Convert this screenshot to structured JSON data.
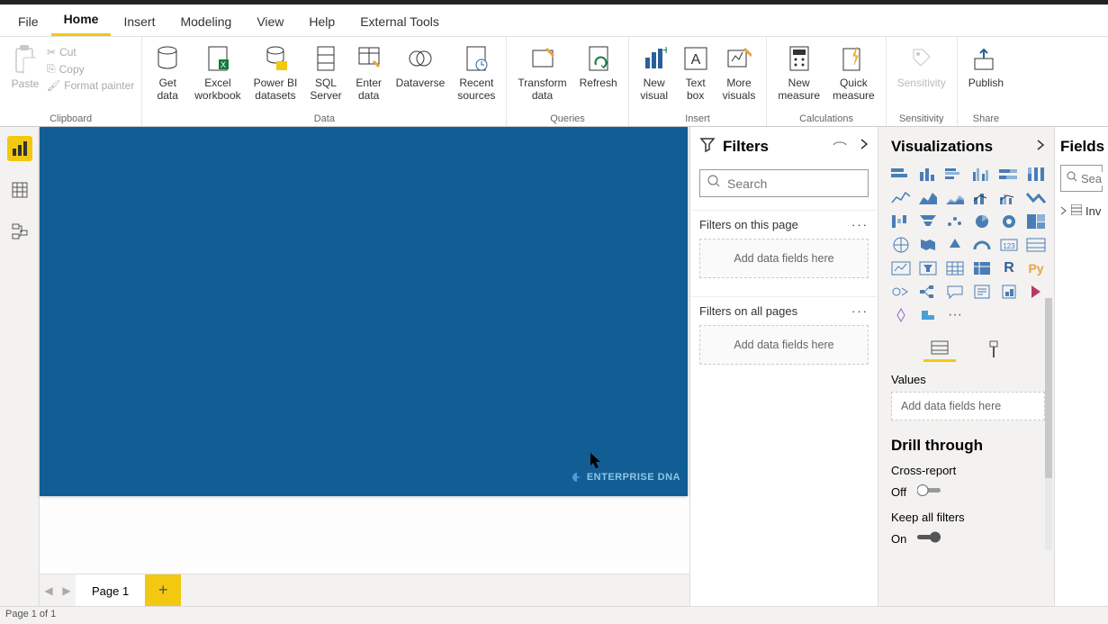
{
  "menu": {
    "file": "File",
    "home": "Home",
    "insert": "Insert",
    "modeling": "Modeling",
    "view": "View",
    "help": "Help",
    "external": "External Tools"
  },
  "clipboard": {
    "group": "Clipboard",
    "paste": "Paste",
    "cut": "Cut",
    "copy": "Copy",
    "format_painter": "Format painter"
  },
  "datagrp": {
    "group": "Data",
    "get_data": "Get\ndata",
    "excel": "Excel\nworkbook",
    "pbi_ds": "Power BI\ndatasets",
    "sql": "SQL\nServer",
    "enter": "Enter\ndata",
    "dataverse": "Dataverse",
    "recent": "Recent\nsources"
  },
  "queries": {
    "group": "Queries",
    "transform": "Transform\ndata",
    "refresh": "Refresh"
  },
  "insertgrp": {
    "group": "Insert",
    "new_visual": "New\nvisual",
    "text_box": "Text\nbox",
    "more": "More\nvisuals"
  },
  "calc": {
    "group": "Calculations",
    "new_measure": "New\nmeasure",
    "quick": "Quick\nmeasure"
  },
  "sens": {
    "group": "Sensitivity",
    "label": "Sensitivity"
  },
  "share": {
    "group": "Share",
    "publish": "Publish"
  },
  "filters": {
    "title": "Filters",
    "search_ph": "Search",
    "on_page": "Filters on this page",
    "on_all": "Filters on all pages",
    "add_here": "Add data fields here"
  },
  "viz": {
    "title": "Visualizations",
    "values": "Values",
    "add_here": "Add data fields here",
    "drill": "Drill through",
    "cross_report": "Cross-report",
    "off": "Off",
    "keep": "Keep all filters",
    "on": "On"
  },
  "fields": {
    "title": "Fields",
    "search_ph": "Sea",
    "item1": "Inv"
  },
  "pager": {
    "page1": "Page 1"
  },
  "status": "Page 1 of 1",
  "canvas": {
    "logo": "ENTERPRISE DNA"
  }
}
